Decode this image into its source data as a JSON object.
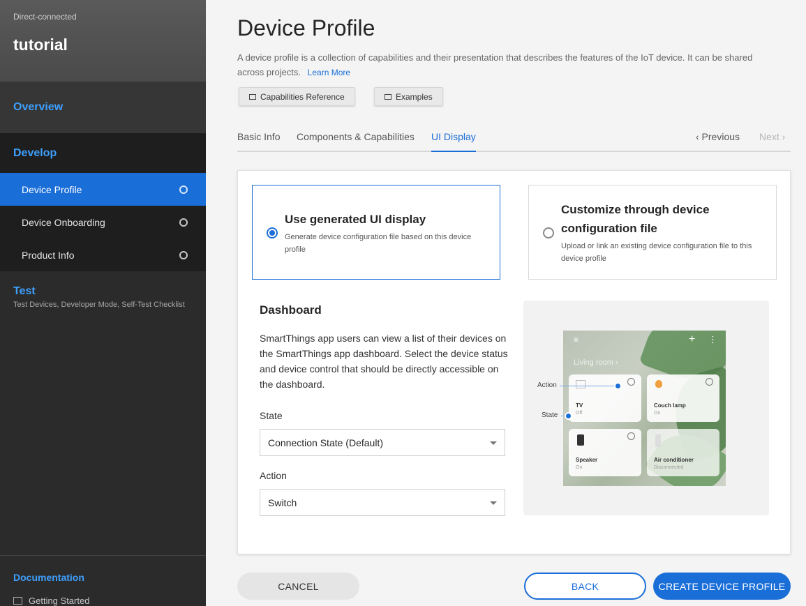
{
  "sidebar": {
    "subtitle": "Direct-connected",
    "project_name": "tutorial",
    "overview_label": "Overview",
    "develop_label": "Develop",
    "develop_items": [
      {
        "label": "Device Profile"
      },
      {
        "label": "Device Onboarding"
      },
      {
        "label": "Product Info"
      }
    ],
    "test_label": "Test",
    "test_desc": "Test Devices, Developer Mode, Self-Test Checklist",
    "docs_label": "Documentation",
    "docs_link": "Getting Started"
  },
  "header": {
    "title": "Device Profile",
    "description": "A device profile is a collection of capabilities and their presentation that describes the features of the IoT device. It can be shared across projects.",
    "learn_more": "Learn More",
    "capabilities_ref": "Capabilities Reference",
    "examples": "Examples"
  },
  "tabs": [
    {
      "label": "Basic Info"
    },
    {
      "label": "Components & Capabilities"
    },
    {
      "label": "UI Display"
    }
  ],
  "pager": {
    "previous": "‹ Previous",
    "next": "Next ›"
  },
  "options": [
    {
      "title": "Use generated UI display",
      "desc": "Generate device configuration file based on this device profile"
    },
    {
      "title": "Customize through device configuration file",
      "desc": "Upload or link an existing device configuration file to this device profile"
    }
  ],
  "dashboard": {
    "title": "Dashboard",
    "desc": "SmartThings app users can view a list of their devices on the SmartThings app dashboard. Select the device status and device control that should be directly accessible on the dashboard.",
    "state_label": "State",
    "state_value": "Connection State (Default)",
    "action_label": "Action",
    "action_value": "Switch"
  },
  "preview": {
    "room": "Living room  ›",
    "action_label": "Action",
    "state_label": "State",
    "tiles": [
      {
        "name": "TV",
        "sub": "Off"
      },
      {
        "name": "Couch lamp",
        "sub": "On"
      },
      {
        "name": "Speaker",
        "sub": "On"
      },
      {
        "name": "Air conditioner",
        "sub": "Disconnected"
      }
    ]
  },
  "footer": {
    "cancel": "CANCEL",
    "back": "BACK",
    "create": "CREATE DEVICE PROFILE"
  },
  "colors": {
    "accent": "#1a6ed8",
    "sidebar_bg": "#2b2b2b",
    "sidebar_link": "#3ea0ff"
  }
}
